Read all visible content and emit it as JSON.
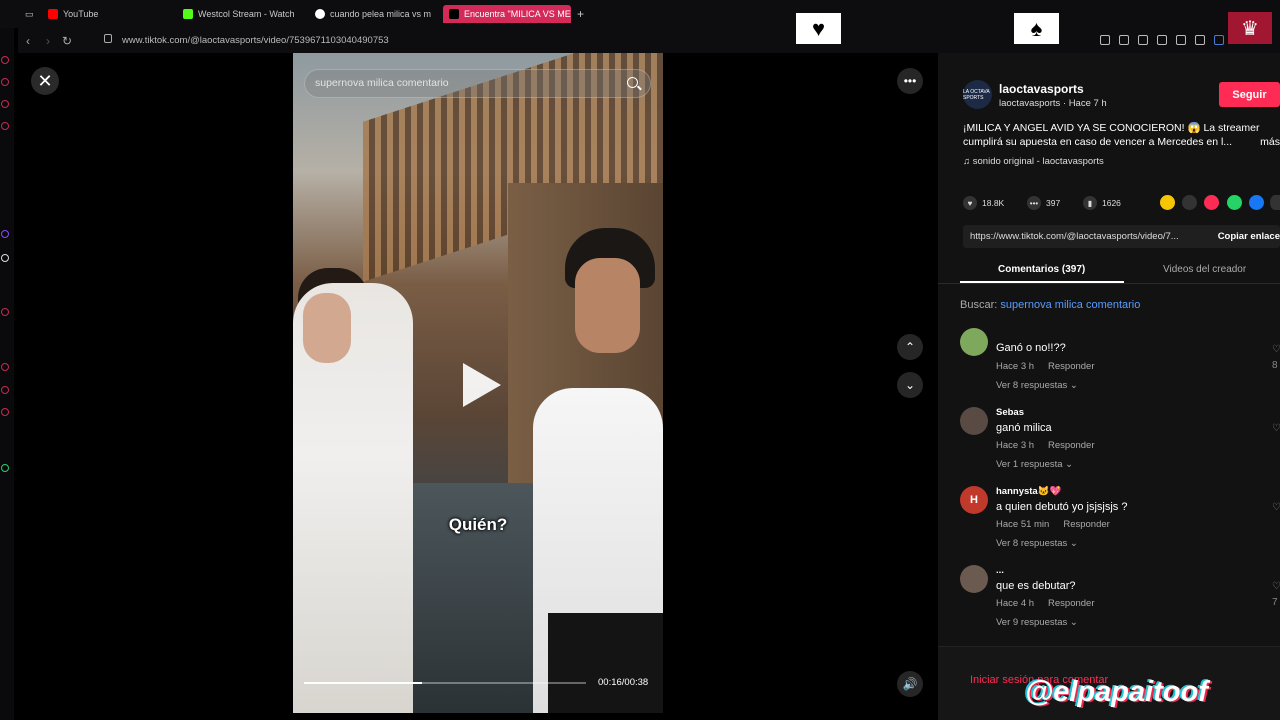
{
  "browser": {
    "tabs": [
      {
        "label": "YouTube",
        "color": "#ff0000"
      },
      {
        "label": "Westcol Stream - Watch",
        "color": "#53fc18"
      },
      {
        "label": "cuando pelea milica vs m",
        "color": "#ffffff"
      },
      {
        "label": "Encuentra \"MILICA VS ME",
        "color": "#000000",
        "active": true
      }
    ],
    "new_tab": "+",
    "url": "www.tiktok.com/@laoctavasports/video/7539671103040490753"
  },
  "overlay": {
    "heart_box": "♥",
    "spade_box": "♠",
    "crown": "♛"
  },
  "video": {
    "search_text": "supernova milica comentario",
    "caption": "Quién?",
    "time": "00:16/00:38",
    "progress_fraction": 0.42
  },
  "panel": {
    "creator_name": "laoctavasports",
    "creator_sub": "laoctavasports · Hace 7 h",
    "avatar_text": "LA OCTAVA SPORTS",
    "follow_label": "Seguir",
    "description": "¡MILICA Y ANGEL AVID YA SE CONOCIERON! 😱 La streamer cumplirá su apuesta en caso de vencer a Mercedes en l...",
    "more": "más",
    "sound": "♫  sonido original - laoctavasports",
    "likes": "18.8K",
    "comments": "397",
    "saves": "1626",
    "link": "https://www.tiktok.com/@laoctavasports/video/7...",
    "copy_label": "Copiar enlace",
    "tab_comments": "Comentarios (397)",
    "tab_creator": "Videos del creador",
    "search_prefix": "Buscar: ",
    "search_term": "supernova milica comentario",
    "comment_list": [
      {
        "name": "",
        "text": "Ganó o no!!??",
        "time": "Hace 3 h",
        "reply": "Responder",
        "replies": "Ver 8 respuestas ⌄",
        "like_count": "8",
        "avatar_color": "#7ea85c",
        "avatar_text": ""
      },
      {
        "name": "Sebas",
        "text": "ganó milica",
        "time": "Hace 3 h",
        "reply": "Responder",
        "replies": "Ver 1 respuesta ⌄",
        "like_count": "",
        "avatar_color": "#5a4a44",
        "avatar_text": ""
      },
      {
        "name": "hannysta🐱💖",
        "text": "a quien debutó yo jsjsjsjs ?",
        "time": "Hace 51 min",
        "reply": "Responder",
        "replies": "Ver 8 respuestas ⌄",
        "like_count": "",
        "avatar_color": "#c0392b",
        "avatar_text": "H"
      },
      {
        "name": "...",
        "text": "que es debutar?",
        "time": "Hace 4 h",
        "reply": "Responder",
        "replies": "Ver 9 respuestas ⌄",
        "like_count": "7",
        "avatar_color": "#6b5a50",
        "avatar_text": ""
      }
    ],
    "login_label": "Iniciar sesión para comentar"
  },
  "watermark": "@elpapaitoof"
}
